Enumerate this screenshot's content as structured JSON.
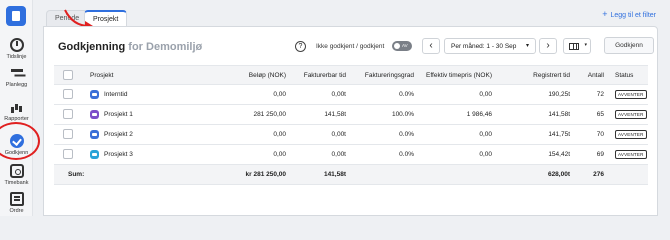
{
  "sidebar": {
    "items": [
      {
        "label": "Tidslinje",
        "icon": "clock-icon"
      },
      {
        "label": "Planlegg",
        "icon": "planner-icon"
      },
      {
        "label": "Rapporter",
        "icon": "bar-chart-icon"
      },
      {
        "label": "Godkjenn",
        "icon": "check-circle-icon"
      },
      {
        "label": "Timebank",
        "icon": "timebank-icon"
      },
      {
        "label": "Ordre",
        "icon": "order-icon"
      }
    ]
  },
  "tabs": [
    {
      "label": "Periode"
    },
    {
      "label": "Prosjekt"
    }
  ],
  "toolbar": {
    "add_filter": "Legg til et filter",
    "add_symbol": "+"
  },
  "header": {
    "title": "Godkjenning",
    "subtitle": "for Demomiljø",
    "help": "?",
    "toggle_label": "Ikke godkjent / godkjent",
    "toggle_state": "AV",
    "prev": "‹",
    "next": "›",
    "period": "Per måned: 1 - 30 Sep",
    "caret": "▾",
    "approve_button": "Godkjenn"
  },
  "table": {
    "columns": [
      "Prosjekt",
      "Beløp (NOK)",
      "Fakturerbar tid",
      "Faktureringsgrad",
      "Effektiv timepris (NOK)",
      "Registrert tid",
      "Antall",
      "Status"
    ],
    "rows": [
      {
        "name": "Interntid",
        "color": "#3a6fd8",
        "amount": "0,00",
        "billable": "0,00t",
        "rate": "0.0%",
        "hourly": "0,00",
        "registered": "190,25t",
        "count": "72",
        "status": "AVVENTER"
      },
      {
        "name": "Prosjekt 1",
        "color": "#7b4fc9",
        "amount": "281 250,00",
        "billable": "141,58t",
        "rate": "100.0%",
        "hourly": "1 986,46",
        "registered": "141,58t",
        "count": "65",
        "status": "AVVENTER"
      },
      {
        "name": "Prosjekt 2",
        "color": "#3a6fd8",
        "amount": "0,00",
        "billable": "0,00t",
        "rate": "0.0%",
        "hourly": "0,00",
        "registered": "141,75t",
        "count": "70",
        "status": "AVVENTER"
      },
      {
        "name": "Prosjekt 3",
        "color": "#2aa3d8",
        "amount": "0,00",
        "billable": "0,00t",
        "rate": "0.0%",
        "hourly": "0,00",
        "registered": "154,42t",
        "count": "69",
        "status": "AVVENTER"
      }
    ],
    "sum": {
      "label": "Sum:",
      "amount": "kr 281 250,00",
      "billable": "141,58t",
      "registered": "628,00t",
      "count": "276"
    }
  }
}
